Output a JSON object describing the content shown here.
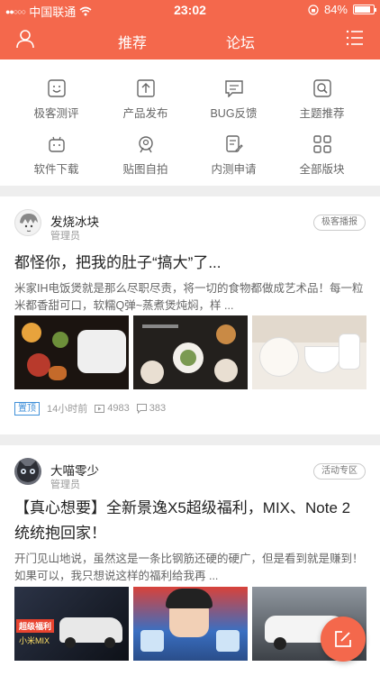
{
  "status_bar": {
    "carrier": "中国联通",
    "time": "23:02",
    "battery": "84%",
    "battery_level": 0.84
  },
  "nav": {
    "tab_recommend": "推荐",
    "tab_forum": "论坛"
  },
  "categories": [
    {
      "label": "极客测评",
      "icon": "smiley-box-icon"
    },
    {
      "label": "产品发布",
      "icon": "upload-box-icon"
    },
    {
      "label": "BUG反馈",
      "icon": "message-box-icon"
    },
    {
      "label": "主题推荐",
      "icon": "search-box-icon"
    },
    {
      "label": "软件下载",
      "icon": "robot-icon"
    },
    {
      "label": "贴图自拍",
      "icon": "person-photo-icon"
    },
    {
      "label": "内测申请",
      "icon": "edit-document-icon"
    },
    {
      "label": "全部版块",
      "icon": "grid-icon"
    }
  ],
  "posts": [
    {
      "username": "发烧冰块",
      "role": "管理员",
      "tag": "极客播报",
      "title": "都怪你，把我的肚子“搞大”了...",
      "summary": "米家IH电饭煲就是那么尽职尽责，将一切的食物都做成艺术品！每一粒米都香甜可口，软糯Q弹~蒸煮煲炖焖，样 ...",
      "pinned": "置顶",
      "time": "14小时前",
      "views": "4983",
      "comments": "383"
    },
    {
      "username": "大喵零少",
      "role": "管理员",
      "tag": "活动专区",
      "title": "【真心想要】全新景逸X5超级福利，MIX、Note 2统统抱回家！",
      "summary": "开门见山地说，虽然这是一条比钢筋还硬的硬广，但是看到就是赚到！如果可以，我只想说这样的福利给我再 ...",
      "thumb1_caption": "超级福利",
      "thumb1_caption2": "小米MIX"
    }
  ]
}
